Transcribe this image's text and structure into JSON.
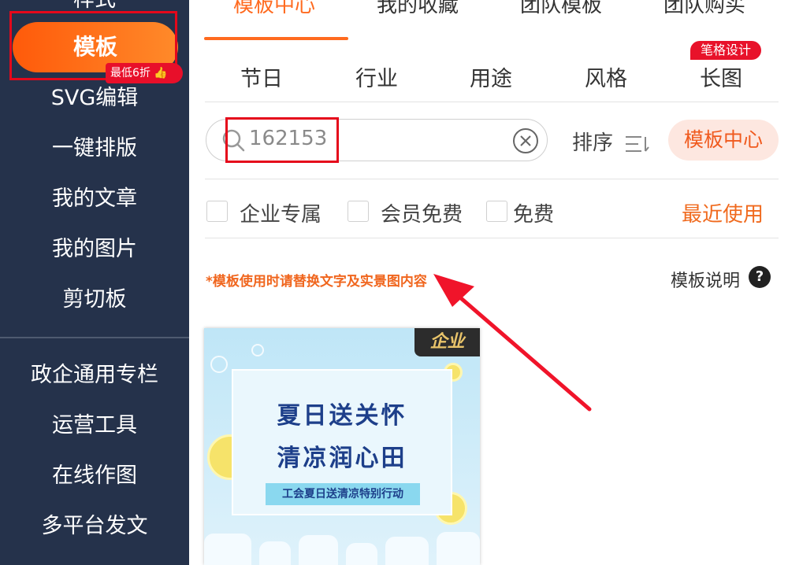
{
  "sidebar": {
    "items_top_partial": "样式",
    "active": "模板",
    "discount_badge": "最低6折",
    "items": [
      "SVG编辑",
      "一键排版",
      "我的文章",
      "我的图片",
      "剪切板"
    ],
    "items_bottom": [
      "政企通用专栏",
      "运营工具",
      "在线作图",
      "多平台发文"
    ]
  },
  "top_tabs": [
    "模板中心",
    "我的收藏",
    "团队模板",
    "团队购买"
  ],
  "categories": [
    "节日",
    "行业",
    "用途",
    "风格",
    "长图"
  ],
  "category_badge": "笔格设计",
  "search": {
    "value": "162153"
  },
  "sort_label": "排序",
  "template_center_button": "模板中心",
  "filters": [
    "企业专属",
    "会员免费",
    "免费"
  ],
  "recent_link": "最近使用",
  "notice": "*模板使用时请替换文字及实景图内容",
  "template_explain": "模板说明",
  "card": {
    "badge": "企业",
    "title_line1": "夏日送关怀",
    "title_line2": "清凉润心田",
    "subtitle": "工会夏日送清凉特别行动"
  },
  "colors": {
    "sidebar_bg": "#25324b",
    "accent": "#ff6a1f",
    "highlight_red": "#e5081b"
  }
}
